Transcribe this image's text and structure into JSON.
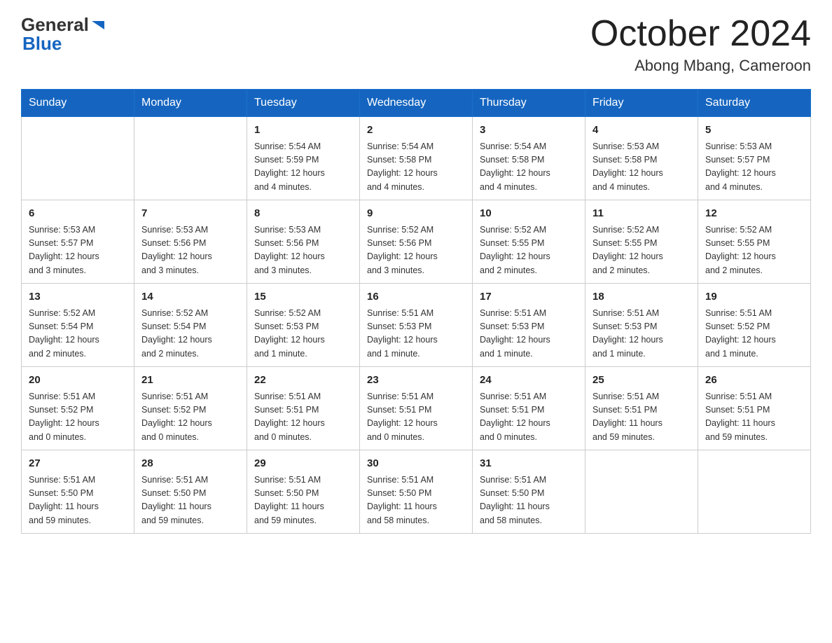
{
  "header": {
    "logo": {
      "general_text": "General",
      "blue_text": "Blue"
    },
    "title": "October 2024",
    "location": "Abong Mbang, Cameroon"
  },
  "calendar": {
    "days_of_week": [
      "Sunday",
      "Monday",
      "Tuesday",
      "Wednesday",
      "Thursday",
      "Friday",
      "Saturday"
    ],
    "weeks": [
      [
        {
          "day": "",
          "info": ""
        },
        {
          "day": "",
          "info": ""
        },
        {
          "day": "1",
          "info": "Sunrise: 5:54 AM\nSunset: 5:59 PM\nDaylight: 12 hours\nand 4 minutes."
        },
        {
          "day": "2",
          "info": "Sunrise: 5:54 AM\nSunset: 5:58 PM\nDaylight: 12 hours\nand 4 minutes."
        },
        {
          "day": "3",
          "info": "Sunrise: 5:54 AM\nSunset: 5:58 PM\nDaylight: 12 hours\nand 4 minutes."
        },
        {
          "day": "4",
          "info": "Sunrise: 5:53 AM\nSunset: 5:58 PM\nDaylight: 12 hours\nand 4 minutes."
        },
        {
          "day": "5",
          "info": "Sunrise: 5:53 AM\nSunset: 5:57 PM\nDaylight: 12 hours\nand 4 minutes."
        }
      ],
      [
        {
          "day": "6",
          "info": "Sunrise: 5:53 AM\nSunset: 5:57 PM\nDaylight: 12 hours\nand 3 minutes."
        },
        {
          "day": "7",
          "info": "Sunrise: 5:53 AM\nSunset: 5:56 PM\nDaylight: 12 hours\nand 3 minutes."
        },
        {
          "day": "8",
          "info": "Sunrise: 5:53 AM\nSunset: 5:56 PM\nDaylight: 12 hours\nand 3 minutes."
        },
        {
          "day": "9",
          "info": "Sunrise: 5:52 AM\nSunset: 5:56 PM\nDaylight: 12 hours\nand 3 minutes."
        },
        {
          "day": "10",
          "info": "Sunrise: 5:52 AM\nSunset: 5:55 PM\nDaylight: 12 hours\nand 2 minutes."
        },
        {
          "day": "11",
          "info": "Sunrise: 5:52 AM\nSunset: 5:55 PM\nDaylight: 12 hours\nand 2 minutes."
        },
        {
          "day": "12",
          "info": "Sunrise: 5:52 AM\nSunset: 5:55 PM\nDaylight: 12 hours\nand 2 minutes."
        }
      ],
      [
        {
          "day": "13",
          "info": "Sunrise: 5:52 AM\nSunset: 5:54 PM\nDaylight: 12 hours\nand 2 minutes."
        },
        {
          "day": "14",
          "info": "Sunrise: 5:52 AM\nSunset: 5:54 PM\nDaylight: 12 hours\nand 2 minutes."
        },
        {
          "day": "15",
          "info": "Sunrise: 5:52 AM\nSunset: 5:53 PM\nDaylight: 12 hours\nand 1 minute."
        },
        {
          "day": "16",
          "info": "Sunrise: 5:51 AM\nSunset: 5:53 PM\nDaylight: 12 hours\nand 1 minute."
        },
        {
          "day": "17",
          "info": "Sunrise: 5:51 AM\nSunset: 5:53 PM\nDaylight: 12 hours\nand 1 minute."
        },
        {
          "day": "18",
          "info": "Sunrise: 5:51 AM\nSunset: 5:53 PM\nDaylight: 12 hours\nand 1 minute."
        },
        {
          "day": "19",
          "info": "Sunrise: 5:51 AM\nSunset: 5:52 PM\nDaylight: 12 hours\nand 1 minute."
        }
      ],
      [
        {
          "day": "20",
          "info": "Sunrise: 5:51 AM\nSunset: 5:52 PM\nDaylight: 12 hours\nand 0 minutes."
        },
        {
          "day": "21",
          "info": "Sunrise: 5:51 AM\nSunset: 5:52 PM\nDaylight: 12 hours\nand 0 minutes."
        },
        {
          "day": "22",
          "info": "Sunrise: 5:51 AM\nSunset: 5:51 PM\nDaylight: 12 hours\nand 0 minutes."
        },
        {
          "day": "23",
          "info": "Sunrise: 5:51 AM\nSunset: 5:51 PM\nDaylight: 12 hours\nand 0 minutes."
        },
        {
          "day": "24",
          "info": "Sunrise: 5:51 AM\nSunset: 5:51 PM\nDaylight: 12 hours\nand 0 minutes."
        },
        {
          "day": "25",
          "info": "Sunrise: 5:51 AM\nSunset: 5:51 PM\nDaylight: 11 hours\nand 59 minutes."
        },
        {
          "day": "26",
          "info": "Sunrise: 5:51 AM\nSunset: 5:51 PM\nDaylight: 11 hours\nand 59 minutes."
        }
      ],
      [
        {
          "day": "27",
          "info": "Sunrise: 5:51 AM\nSunset: 5:50 PM\nDaylight: 11 hours\nand 59 minutes."
        },
        {
          "day": "28",
          "info": "Sunrise: 5:51 AM\nSunset: 5:50 PM\nDaylight: 11 hours\nand 59 minutes."
        },
        {
          "day": "29",
          "info": "Sunrise: 5:51 AM\nSunset: 5:50 PM\nDaylight: 11 hours\nand 59 minutes."
        },
        {
          "day": "30",
          "info": "Sunrise: 5:51 AM\nSunset: 5:50 PM\nDaylight: 11 hours\nand 58 minutes."
        },
        {
          "day": "31",
          "info": "Sunrise: 5:51 AM\nSunset: 5:50 PM\nDaylight: 11 hours\nand 58 minutes."
        },
        {
          "day": "",
          "info": ""
        },
        {
          "day": "",
          "info": ""
        }
      ]
    ]
  }
}
